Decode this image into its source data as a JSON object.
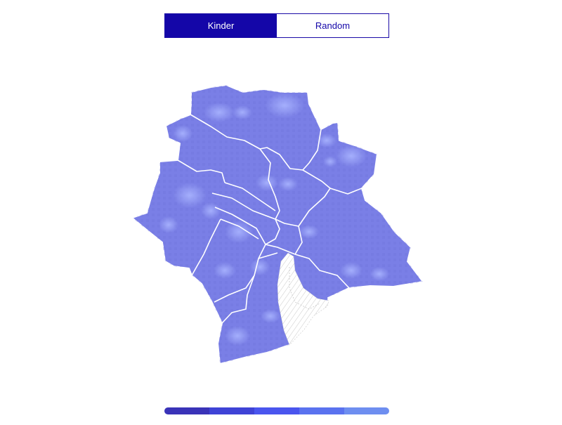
{
  "toggle": {
    "options": [
      {
        "label": "Kinder",
        "active": true
      },
      {
        "label": "Random",
        "active": false
      }
    ]
  },
  "colors": {
    "accent": "#1406a8",
    "map_fill": "#7a7fe6",
    "map_fill_light": "#9aa4ff",
    "map_fill_dark": "#6a6fd6",
    "district_border": "#ffffff",
    "lake_hatch": "#c8c8c8"
  },
  "legend": {
    "steps": [
      "#3a33b8",
      "#3f43d6",
      "#4a55ee",
      "#5a72ef",
      "#6e8ef0"
    ]
  }
}
